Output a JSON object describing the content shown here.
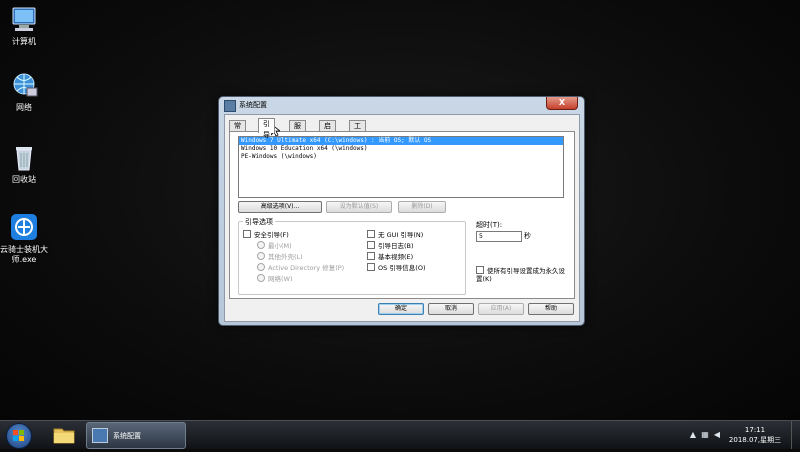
{
  "desktop": {
    "icons": [
      {
        "label": "计算机"
      },
      {
        "label": "网络"
      },
      {
        "label": "回收站"
      },
      {
        "label": "云骑士装机大师.exe"
      }
    ]
  },
  "dialog": {
    "title": "系统配置",
    "close_label": "X",
    "tabs": [
      {
        "label": "常规"
      },
      {
        "label": "引导"
      },
      {
        "label": "服务"
      },
      {
        "label": "启动"
      },
      {
        "label": "工具"
      }
    ],
    "active_tab": "引导",
    "os_list": [
      "Windows 7 Ultimate x64 (C:\\windows) : 当前 OS; 默认 OS",
      "Windows 10 Education x64 (\\windows)",
      "PE-Windows (\\windows)"
    ],
    "buttons": {
      "advanced": "高级选项(V)...",
      "set_default": "设为默认值(S)",
      "delete": "删除(D)"
    },
    "boot_options": {
      "title": "引导选项",
      "safe_boot": "安全引导(F)",
      "minimal": "最小(M)",
      "alternate_shell": "其他外壳(L)",
      "ad_repair": "Active Directory 修复(P)",
      "network": "网络(W)",
      "no_gui": "无 GUI 引导(N)",
      "boot_log": "引导日志(B)",
      "base_video": "基本视频(E)",
      "os_boot_info": "OS 引导信息(O)"
    },
    "timeout": {
      "label": "超时(T):",
      "value": "5",
      "unit": "秒"
    },
    "make_permanent": "使所有引导设置成为永久设置(K)",
    "footer": {
      "ok": "确定",
      "cancel": "取消",
      "apply": "应用(A)",
      "help": "帮助"
    }
  },
  "taskbar": {
    "task_label": "系统配置",
    "time": "17:11",
    "date": "2018.07,星期三"
  }
}
